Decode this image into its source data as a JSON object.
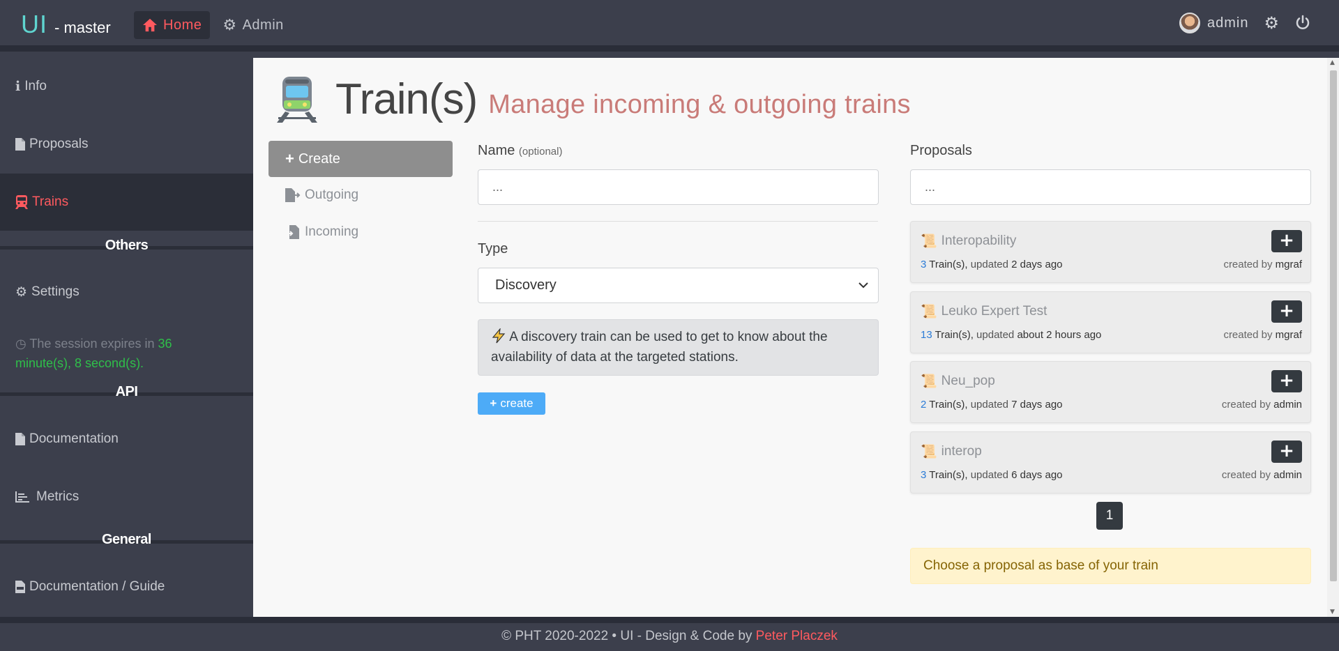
{
  "app": {
    "brand": "UI",
    "brand_suffix": "- master"
  },
  "topnav": [
    {
      "label": "Home",
      "icon": "home-icon",
      "active": true
    },
    {
      "label": "Admin",
      "icon": "gear-icon",
      "active": false
    }
  ],
  "user": {
    "name": "admin"
  },
  "sidebar": {
    "items": [
      {
        "label": "Info",
        "icon": "info-icon"
      },
      {
        "label": "Proposals",
        "icon": "file-icon"
      },
      {
        "label": "Trains",
        "icon": "train-icon",
        "active": true
      },
      {
        "label": "Settings",
        "icon": "gear-icon"
      },
      {
        "label": "Documentation",
        "icon": "file-icon"
      },
      {
        "label": "Metrics",
        "icon": "chart-icon"
      },
      {
        "label": "Documentation / Guide",
        "icon": "pdf-icon"
      }
    ],
    "headings": {
      "others": "Others",
      "api": "API",
      "general": "General"
    },
    "session": {
      "prefix": "The session expires in",
      "time": "36 minute(s), 8 second(s)."
    }
  },
  "page": {
    "title": "Train(s)",
    "subtitle": "Manage incoming & outgoing trains"
  },
  "subnav": {
    "create": "Create",
    "outgoing": "Outgoing",
    "incoming": "Incoming"
  },
  "form": {
    "name_label": "Name",
    "name_hint": "(optional)",
    "name_placeholder": "...",
    "type_label": "Type",
    "type_value": "Discovery",
    "type_info": "A discovery train can be used to get to know about the availability of data at the targeted stations.",
    "create_button": "create"
  },
  "proposals": {
    "label": "Proposals",
    "search_placeholder": "...",
    "trains_word": "Train(s),",
    "updated_word": "updated",
    "created_by_word": "created by",
    "items": [
      {
        "title": "Interopability",
        "count": "3",
        "updated": "2 days ago",
        "author": "mgraf"
      },
      {
        "title": "Leuko Expert Test",
        "count": "13",
        "updated": "about 2 hours ago",
        "author": "mgraf"
      },
      {
        "title": "Neu_pop",
        "count": "2",
        "updated": "7 days ago",
        "author": "admin"
      },
      {
        "title": "interop",
        "count": "3",
        "updated": "6 days ago",
        "author": "admin"
      }
    ],
    "page": "1",
    "hint": "Choose a proposal as base of your train"
  },
  "footer": {
    "text": "© PHT 2020-2022 • UI - Design & Code by",
    "author": "Peter Placzek"
  },
  "colors": {
    "accent": "#ff5a5f",
    "subtitle": "#c97b78",
    "primary_button": "#4dabf7",
    "dark_button": "#343a40"
  }
}
